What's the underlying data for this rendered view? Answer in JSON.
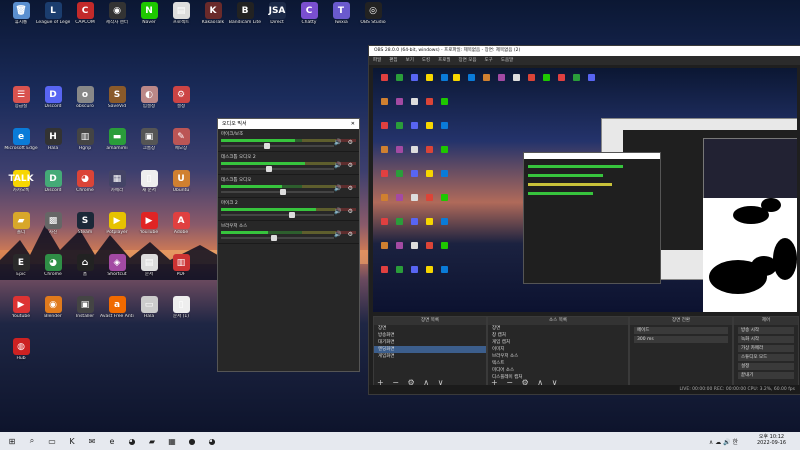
{
  "desktop": {
    "icons": [
      {
        "label": "휴지통",
        "glyph": "🗑",
        "color": "#5a8fd0"
      },
      {
        "label": "League of Legends",
        "glyph": "L",
        "color": "#1b3d6e"
      },
      {
        "label": "CAPCOM",
        "glyph": "C",
        "color": "#c32a2a"
      },
      {
        "label": "제작자 센터",
        "glyph": "◉",
        "color": "#333"
      },
      {
        "label": "Naver",
        "glyph": "N",
        "color": "#1ec800"
      },
      {
        "label": "프로젝트",
        "glyph": "▤",
        "color": "#ddd"
      },
      {
        "label": "KakaoTalk",
        "glyph": "K",
        "color": "#6a2a2a"
      },
      {
        "label": "Bandicam Lite",
        "glyph": "B",
        "color": "#222"
      },
      {
        "label": "Direct",
        "glyph": "JSA",
        "color": "#1c2a48"
      },
      {
        "label": "Chatty",
        "glyph": "C",
        "color": "#7a4fd0"
      },
      {
        "label": "Twixia",
        "glyph": "T",
        "color": "#6a5acd"
      },
      {
        "label": "OBS Studio",
        "glyph": "◎",
        "color": "#222"
      },
      {
        "label": "응급실",
        "glyph": "☰",
        "color": "#d9534f"
      },
      {
        "label": "Discord",
        "glyph": "D",
        "color": "#5865f2"
      },
      {
        "label": "obscuro",
        "glyph": "o",
        "color": "#888"
      },
      {
        "label": "SaveVid",
        "glyph": "S",
        "color": "#8a5a2a"
      },
      {
        "label": "입설정",
        "glyph": "◐",
        "color": "#b88"
      },
      {
        "label": "설정",
        "glyph": "⚙",
        "color": "#c44"
      },
      {
        "label": "Microsoft Edge",
        "glyph": "e",
        "color": "#0a7bd8"
      },
      {
        "label": "Hala",
        "glyph": "H",
        "color": "#333"
      },
      {
        "label": "Hgrip",
        "glyph": "▥",
        "color": "#444"
      },
      {
        "label": "amamimi",
        "glyph": "▬",
        "color": "#2a9d3a"
      },
      {
        "label": "크롬창",
        "glyph": "▣",
        "color": "#555"
      },
      {
        "label": "메모장",
        "glyph": "✎",
        "color": "#b55"
      },
      {
        "label": "카카오톡",
        "glyph": "TALK",
        "color": "#f7d600"
      },
      {
        "label": "Discord",
        "glyph": "D",
        "color": "#4a7"
      },
      {
        "label": "Chrome",
        "glyph": "◕",
        "color": "#db4437"
      },
      {
        "label": "카메라",
        "glyph": "▦",
        "color": "#446"
      },
      {
        "label": "새 문서",
        "glyph": "▯",
        "color": "#eee"
      },
      {
        "label": "Ubuntu",
        "glyph": "U",
        "color": "#d08030"
      },
      {
        "label": "폴더",
        "glyph": "▰",
        "color": "#d8a72a"
      },
      {
        "label": "사진",
        "glyph": "▩",
        "color": "#666"
      },
      {
        "label": "Steam",
        "glyph": "S",
        "color": "#1b2838"
      },
      {
        "label": "Potplayer",
        "glyph": "▶",
        "color": "#e6c200"
      },
      {
        "label": "YouTube",
        "glyph": "▶",
        "color": "#e02424"
      },
      {
        "label": "Adobe",
        "glyph": "A",
        "color": "#e04040"
      },
      {
        "label": "Epic",
        "glyph": "E",
        "color": "#2a2a2a"
      },
      {
        "label": "Chrome",
        "glyph": "◕",
        "color": "#2f8f46"
      },
      {
        "label": "홈",
        "glyph": "⌂",
        "color": "#222"
      },
      {
        "label": "Shortcut",
        "glyph": "◈",
        "color": "#a34aa3"
      },
      {
        "label": "문서",
        "glyph": "▤",
        "color": "#ddd"
      },
      {
        "label": "PDF",
        "glyph": "▥",
        "color": "#c33"
      },
      {
        "label": "Youtube",
        "glyph": "▶",
        "color": "#d33"
      },
      {
        "label": "Blender",
        "glyph": "◉",
        "color": "#e07a1c"
      },
      {
        "label": "Installer",
        "glyph": "▣",
        "color": "#444"
      },
      {
        "label": "Avast Free Antivirus",
        "glyph": "a",
        "color": "#f06a00"
      },
      {
        "label": "Hala",
        "glyph": "▭",
        "color": "#ccc"
      },
      {
        "label": "문서 (1)",
        "glyph": "▯",
        "color": "#eee"
      },
      {
        "label": "Hub",
        "glyph": "◍",
        "color": "#c22"
      }
    ]
  },
  "mixer": {
    "title": "오디오 믹서",
    "close": "✕",
    "channels": [
      {
        "name": "마이크/보조",
        "level": 0.55,
        "vol": 0.38
      },
      {
        "name": "데스크톱 오디오 2",
        "level": 0.62,
        "vol": 0.4
      },
      {
        "name": "데스크톱 오디오",
        "level": 0.45,
        "vol": 0.52
      },
      {
        "name": "마이크 2",
        "level": 0.7,
        "vol": 0.6
      },
      {
        "name": "브라우저 소스",
        "level": 0.35,
        "vol": 0.44
      }
    ],
    "button_icons": "🔊 ⚙"
  },
  "obs": {
    "title": "OBS 28.0.0 (64-bit, windows) - 프로파일: 제목없음 - 장면: 제목없음 (2)",
    "menu": [
      "파일",
      "편집",
      "보기",
      "도킹",
      "프로필",
      "장면 모음",
      "도구",
      "도움말"
    ],
    "scenes": {
      "header": "장면 목록",
      "items": [
        "장면",
        "방송화면",
        "대기화면",
        "엔딩화면",
        "게임화면"
      ],
      "selected": 3
    },
    "sources": {
      "header": "소스 목록",
      "items": [
        "장면",
        "창 캡처",
        "게임 캡처",
        "이미지",
        "브라우저 소스",
        "텍스트",
        "미디어 소스",
        "디스플레이 캡처"
      ]
    },
    "mixer_dock": {
      "header": "오디오 믹서"
    },
    "transitions": {
      "header": "장면 전환",
      "value": "페이드",
      "duration": "300 ms"
    },
    "controls": {
      "header": "제어",
      "items": [
        "방송 시작",
        "녹화 시작",
        "가상 카메라",
        "스튜디오 모드",
        "설정",
        "끝내기"
      ]
    },
    "status": "LIVE: 00:00:00   REC: 00:00:00   CPU: 3.2%, 60.00 fps",
    "footer_buttons": "+ − ⚙ ∧ ∨"
  },
  "taskbar": {
    "apps": [
      {
        "glyph": "⊞",
        "name": "start-icon"
      },
      {
        "glyph": "⌕",
        "name": "search-icon"
      },
      {
        "glyph": "▭",
        "name": "task-view-icon"
      },
      {
        "glyph": "K",
        "name": "kakaotalk-icon"
      },
      {
        "glyph": "✉",
        "name": "mail-icon"
      },
      {
        "glyph": "e",
        "name": "edge-icon"
      },
      {
        "glyph": "◕",
        "name": "chrome-icon"
      },
      {
        "glyph": "▰",
        "name": "explorer-icon"
      },
      {
        "glyph": "▦",
        "name": "store-icon"
      },
      {
        "glyph": "●",
        "name": "obs-icon"
      },
      {
        "glyph": "◕",
        "name": "chrome-2-icon"
      }
    ],
    "time": "오후 10:12",
    "date": "2022-09-16",
    "tray": "∧ ☁ 🔊 한"
  }
}
